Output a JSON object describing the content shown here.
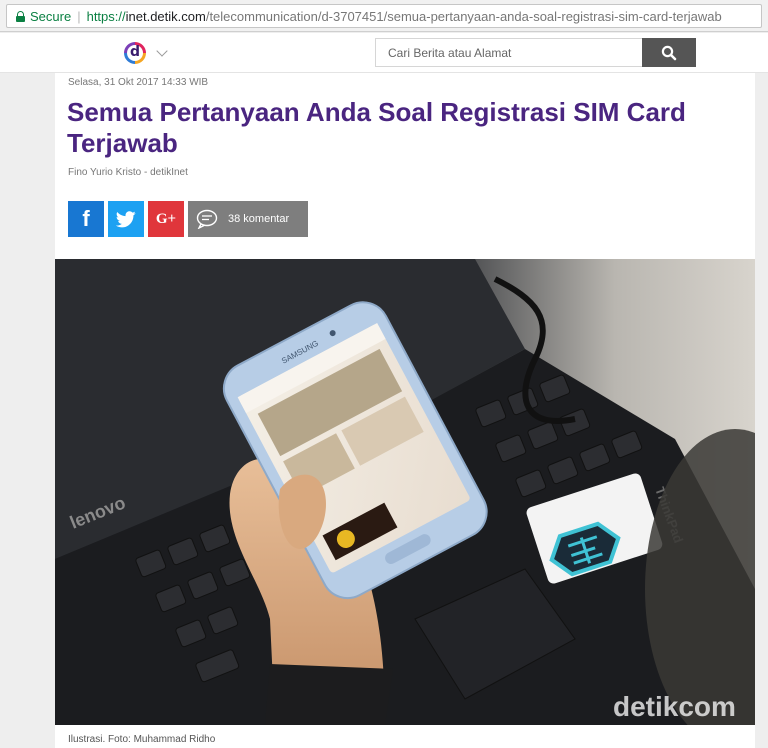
{
  "browser": {
    "secure_label": "Secure",
    "url_protocol": "https://",
    "url_host": "inet.detik.com",
    "url_path": "/telecommunication/d-3707451/semua-pertanyaan-anda-soal-registrasi-sim-card-terjawab"
  },
  "header": {
    "logo_letter": "d",
    "search_placeholder": "Cari Berita atau Alamat"
  },
  "article": {
    "date": "Selasa, 31 Okt 2017 14:33 WIB",
    "title": "Semua Pertanyaan Anda Soal Registrasi SIM Card Terjawab",
    "author": "Fino Yurio Kristo - detikInet",
    "share": {
      "facebook_glyph": "f",
      "google_glyph": "G+",
      "comments_label": "38 komentar"
    },
    "photo": {
      "laptop_brand": "lenovo",
      "laptop_model": "ThinkPad",
      "phone_brand": "SAMSUNG",
      "watermark": "detikcom"
    },
    "caption": "Ilustrasi. Foto: Muhammad Ridho"
  },
  "colors": {
    "title": "#4a2580",
    "facebook": "#1877d2",
    "twitter": "#1da1f2",
    "google": "#e0363b",
    "comments": "#7e7e7e",
    "secure": "#0b8043"
  }
}
